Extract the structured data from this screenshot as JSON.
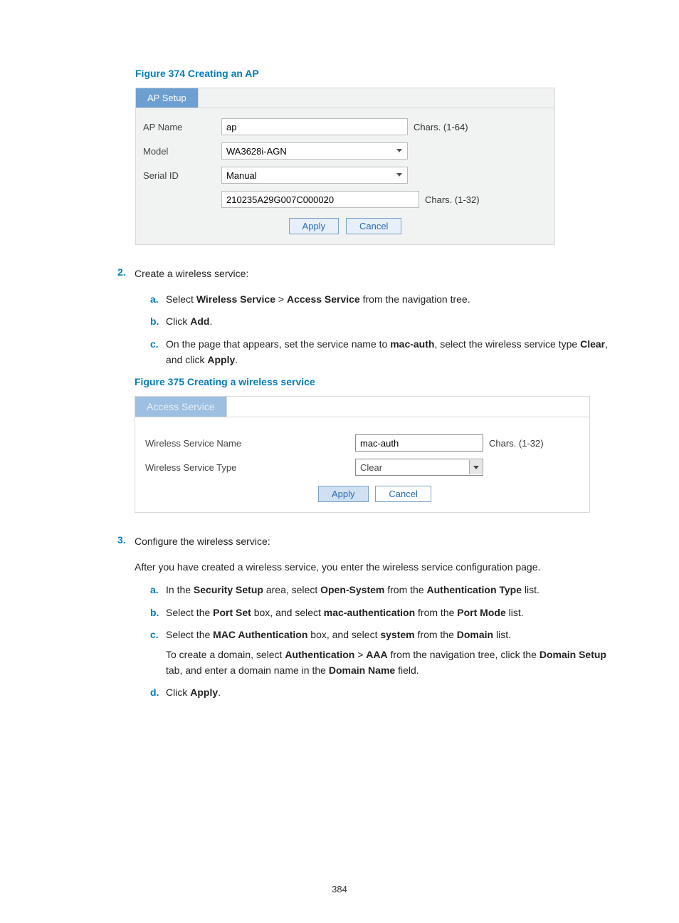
{
  "pageNumber": "384",
  "figure374": {
    "title": "Figure 374 Creating an AP",
    "tab": "AP Setup",
    "rows": {
      "apName": {
        "label": "AP Name",
        "value": "ap",
        "hint": "Chars. (1-64)"
      },
      "model": {
        "label": "Model",
        "value": "WA3628i-AGN"
      },
      "serialId": {
        "label": "Serial ID",
        "value": "Manual"
      },
      "serialVal": {
        "value": "210235A29G007C000020",
        "hint": "Chars. (1-32)"
      }
    },
    "buttons": {
      "apply": "Apply",
      "cancel": "Cancel"
    }
  },
  "step2": {
    "num": "2.",
    "title": "Create a wireless service:",
    "a": {
      "alpha": "a.",
      "pre": "Select ",
      "b1": "Wireless Service",
      "gt": " > ",
      "b2": "Access Service",
      "post": " from the navigation tree."
    },
    "b": {
      "alpha": "b.",
      "pre": "Click ",
      "b1": "Add",
      "post": "."
    },
    "c": {
      "alpha": "c.",
      "pre": "On the page that appears, set the service name to ",
      "b1": "mac-auth",
      "mid": ", select the wireless service type ",
      "b2": "Clear",
      "mid2": ", and click ",
      "b3": "Apply",
      "post": "."
    }
  },
  "figure375": {
    "title": "Figure 375 Creating a wireless service",
    "tab": "Access Service",
    "rows": {
      "name": {
        "label": "Wireless Service Name",
        "value": "mac-auth",
        "hint": "Chars. (1-32)"
      },
      "type": {
        "label": "Wireless Service Type",
        "value": "Clear"
      }
    },
    "buttons": {
      "apply": "Apply",
      "cancel": "Cancel"
    }
  },
  "step3": {
    "num": "3.",
    "title": "Configure the wireless service:",
    "intro": "After you have created a wireless service, you enter the wireless service configuration page.",
    "a": {
      "alpha": "a.",
      "pre": "In the ",
      "b1": "Security Setup",
      "mid1": " area, select ",
      "b2": "Open-System",
      "mid2": " from the ",
      "b3": "Authentication Type",
      "post": " list."
    },
    "b": {
      "alpha": "b.",
      "pre": "Select the ",
      "b1": "Port Set",
      "mid1": " box, and select ",
      "b2": "mac-authentication",
      "mid2": " from the ",
      "b3": "Port Mode",
      "post": " list."
    },
    "c": {
      "alpha": "c.",
      "pre": "Select the ",
      "b1": "MAC Authentication",
      "mid1": " box, and select ",
      "b2": "system",
      "mid2": " from the ",
      "b3": "Domain",
      "post": " list.",
      "extraPre": "To create a domain, select ",
      "eb1": "Authentication",
      "egt": " > ",
      "eb2": "AAA",
      "emid1": " from the navigation tree, click the ",
      "eb3": "Domain Setup",
      "emid2": " tab, and enter a domain name in the ",
      "eb4": "Domain Name",
      "epost": " field."
    },
    "d": {
      "alpha": "d.",
      "pre": "Click ",
      "b1": "Apply",
      "post": "."
    }
  }
}
